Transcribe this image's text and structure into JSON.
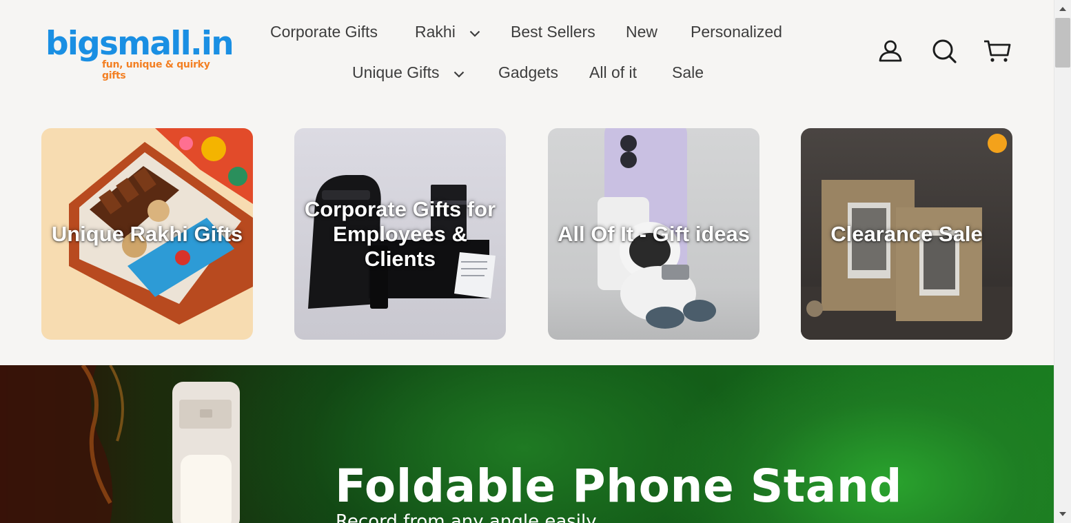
{
  "brand": {
    "name": "bigsmall.in",
    "tagline": "fun, unique & quirky gifts",
    "colors": {
      "primary": "#1a8fe3",
      "accent": "#f37f22"
    }
  },
  "nav": {
    "row1": [
      {
        "label": "Corporate Gifts",
        "has_dropdown": false
      },
      {
        "label": "Rakhi",
        "has_dropdown": true
      },
      {
        "label": "Best Sellers",
        "has_dropdown": false
      },
      {
        "label": "New",
        "has_dropdown": false
      },
      {
        "label": "Personalized",
        "has_dropdown": false
      }
    ],
    "row2": [
      {
        "label": "Unique Gifts",
        "has_dropdown": true
      },
      {
        "label": "Gadgets",
        "has_dropdown": false
      },
      {
        "label": "All of it",
        "has_dropdown": false
      },
      {
        "label": "Sale",
        "has_dropdown": false
      }
    ]
  },
  "header_icons": [
    "account-icon",
    "search-icon",
    "cart-icon"
  ],
  "categories": [
    {
      "title": "Unique Rakhi Gifts"
    },
    {
      "title": "Corporate Gifts for Employees & Clients"
    },
    {
      "title": "All Of It - Gift ideas"
    },
    {
      "title": "Clearance Sale"
    }
  ],
  "hero": {
    "title": "Foldable Phone Stand",
    "subtitle": "Record from any angle easily"
  }
}
